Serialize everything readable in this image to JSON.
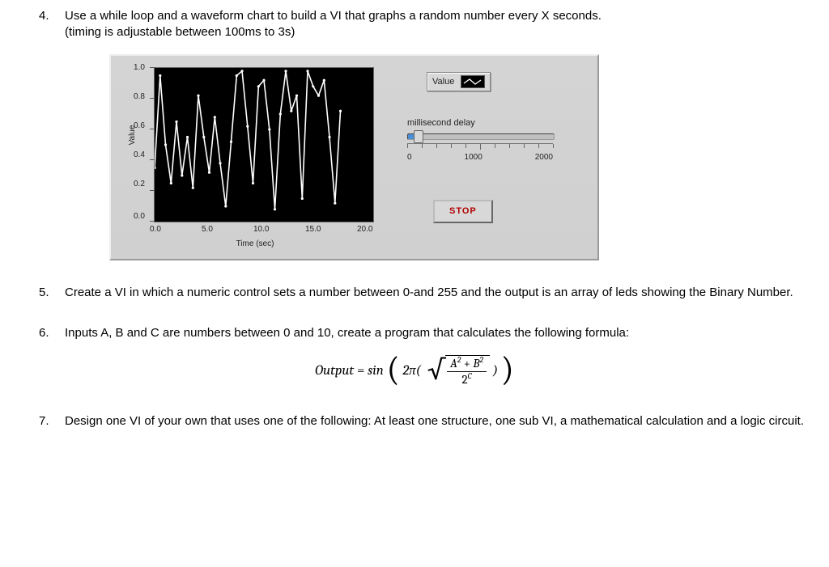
{
  "q4": {
    "number": "4.",
    "text_line1": "Use a while loop and a waveform chart to build a VI that graphs a random number every X seconds.",
    "text_line2": "(timing is adjustable between 100ms to 3s)"
  },
  "panel": {
    "legend_text": "Value",
    "slider_label": "millisecond delay",
    "slider_ticks": {
      "min": "0",
      "mid": "1000",
      "max": "2000"
    },
    "stop_label": "STOP",
    "chart": {
      "ylabel": "Value",
      "xlabel": "Time (sec)",
      "yticks": [
        "1.0",
        "0.8",
        "0.6",
        "0.4",
        "0.2",
        "0.0"
      ],
      "xticks": [
        "0.0",
        "5.0",
        "10.0",
        "15.0",
        "20.0"
      ],
      "data": {
        "x": [
          0,
          0.5,
          1,
          1.5,
          2,
          2.5,
          3,
          3.5,
          4,
          4.5,
          5,
          5.5,
          6,
          6.5,
          7,
          7.5,
          8,
          8.5,
          9,
          9.5,
          10,
          10.5,
          11,
          11.5,
          12,
          12.5,
          13,
          13.5,
          14,
          14.5,
          15,
          15.5,
          16,
          16.5,
          17
        ],
        "y": [
          0.35,
          0.95,
          0.5,
          0.25,
          0.65,
          0.3,
          0.55,
          0.22,
          0.82,
          0.55,
          0.32,
          0.68,
          0.38,
          0.1,
          0.52,
          0.95,
          0.98,
          0.62,
          0.25,
          0.88,
          0.92,
          0.6,
          0.08,
          0.7,
          0.98,
          0.72,
          0.82,
          0.15,
          0.98,
          0.88,
          0.82,
          0.92,
          0.55,
          0.12,
          0.72
        ],
        "xmax": 20,
        "ymax": 1.0
      }
    }
  },
  "q5": {
    "number": "5.",
    "text": "Create a VI in which a numeric control sets a number between 0-and 255 and the output is an array of leds showing the Binary Number."
  },
  "q6": {
    "number": "6.",
    "text": "Inputs A, B and C are numbers between 0 and 10, create a program that calculates the following formula:",
    "formula": {
      "lhs": "Output",
      "func": "sin",
      "twopi": "2π(",
      "num": "A² + B²",
      "den_base": "2",
      "den_exp": "C",
      "close_small": ")"
    }
  },
  "q7": {
    "number": "7.",
    "text": "Design one VI of your own that uses one of the following: At least one structure, one sub VI, a mathematical calculation and a logic circuit."
  }
}
